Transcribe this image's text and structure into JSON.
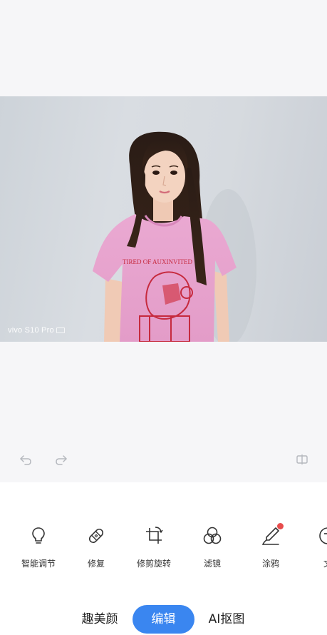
{
  "photo": {
    "watermark": "vivo S10 Pro",
    "shirt_text": "TIRED OF AUXINVITED"
  },
  "history": {
    "undo_icon": "undo-icon",
    "redo_icon": "redo-icon",
    "compare_icon": "compare-icon"
  },
  "tools": [
    {
      "label": "智能调节",
      "icon": "lightbulb-icon"
    },
    {
      "label": "修复",
      "icon": "bandage-icon"
    },
    {
      "label": "修剪旋转",
      "icon": "crop-rotate-icon"
    },
    {
      "label": "滤镜",
      "icon": "filter-circles-icon"
    },
    {
      "label": "涂鸦",
      "icon": "brush-icon",
      "badge": true
    },
    {
      "label": "文",
      "icon": "text-icon"
    }
  ],
  "tabs": [
    {
      "label": "趣美颜",
      "active": false
    },
    {
      "label": "编辑",
      "active": true
    },
    {
      "label": "AI抠图",
      "active": false
    }
  ],
  "colors": {
    "accent": "#3a86f0",
    "badge": "#e74c4c",
    "background": "#f6f6f8"
  }
}
